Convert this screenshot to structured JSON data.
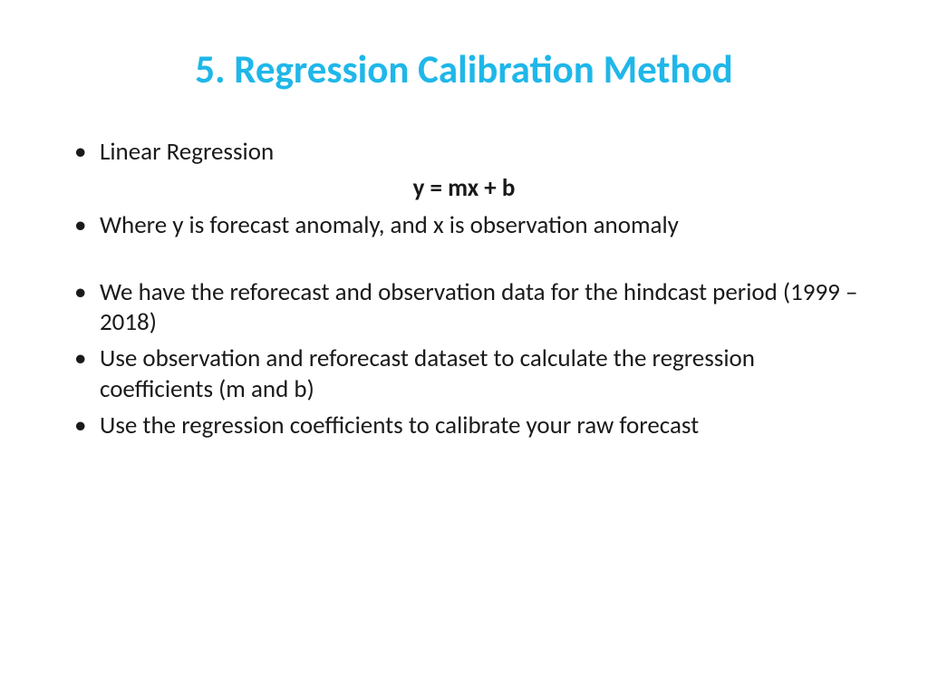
{
  "title": "5. Regression Calibration Method",
  "bullets": {
    "b1": "Linear Regression",
    "equation": "y = mx + b",
    "b2": "Where y is forecast anomaly, and x is observation anomaly",
    "b3": "We have the reforecast and observation data for the hindcast period (1999 – 2018)",
    "b4": "Use observation and reforecast dataset to calculate the regression coefficients (m and b)",
    "b5": "Use the regression coefficients to calibrate your raw forecast"
  }
}
